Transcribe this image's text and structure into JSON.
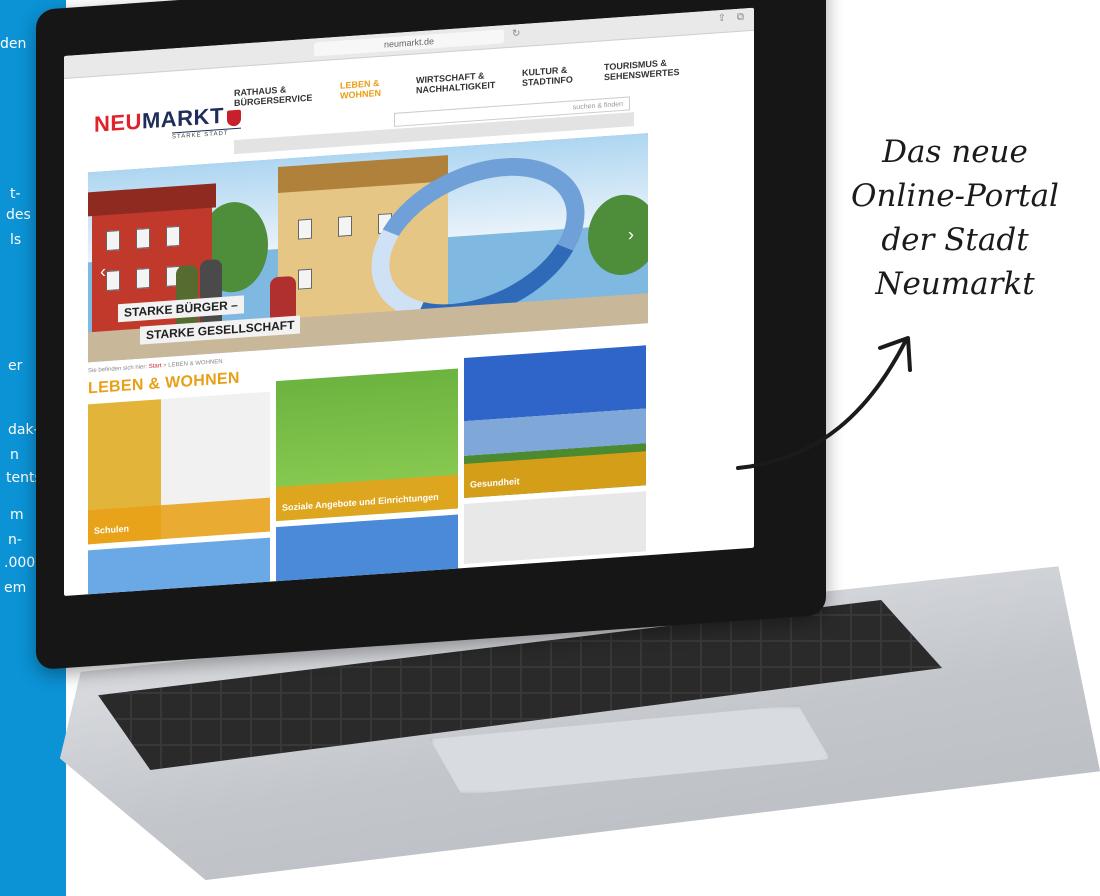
{
  "left_column": {
    "color": "#0b93d6",
    "fragments": [
      "den",
      "t-",
      "des",
      "ls",
      "er",
      "dak-",
      "n",
      "tents",
      "m",
      "n-",
      ".000",
      "em"
    ]
  },
  "browser": {
    "url": "neumarkt.de",
    "reload_icon": "reload-icon",
    "share_icon": "share-icon"
  },
  "site": {
    "logo_prefix": "NEU",
    "logo_suffix": "MARKT",
    "logo_tagline": "STARKE STADT",
    "nav": [
      {
        "label": "RATHAUS & BÜRGERSERVICE",
        "active": false
      },
      {
        "label": "LEBEN & WOHNEN",
        "active": true
      },
      {
        "label": "WIRTSCHAFT & NACHHALTIGKEIT",
        "active": false
      },
      {
        "label": "KULTUR & STADTINFO",
        "active": false
      },
      {
        "label": "TOURISMUS & SEHENSWERTES",
        "active": false
      }
    ],
    "search_placeholder": "suchen & finden",
    "hero_caption_1": "STARKE BÜRGER –",
    "hero_caption_2": "STARKE GESELLSCHAFT",
    "breadcrumb_prefix": "Sie befinden sich hier:",
    "breadcrumb_start": "Start",
    "breadcrumb_current": "LEBEN & WOHNEN",
    "section_title": "LEBEN & WOHNEN",
    "tiles": [
      "Schulen",
      "Soziale Angebote und Einrichtungen",
      "Gesundheit"
    ],
    "accent_color": "#e8a017",
    "brand_red": "#e0232b"
  },
  "handwriting": {
    "line1": "Das neue",
    "line2": "Online-Portal",
    "line3": "der Stadt",
    "line4": "Neumarkt"
  }
}
